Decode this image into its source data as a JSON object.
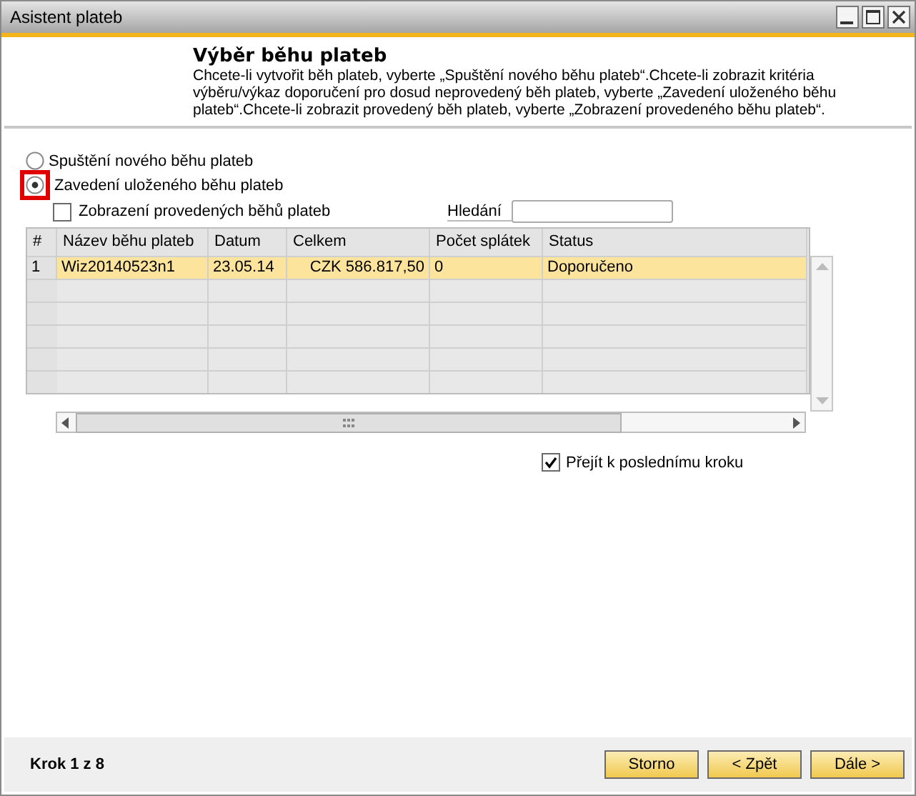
{
  "window": {
    "title": "Asistent plateb"
  },
  "header": {
    "title": "Výběr běhu plateb",
    "description": "Chcete-li vytvořit běh plateb, vyberte „Spuštění nového běhu plateb“.Chcete-li zobrazit kritéria výběru/výkaz doporučení pro dosud neprovedený běh plateb, vyberte „Zavedení uloženého běhu plateb“.Chcete-li zobrazit provedený běh plateb, vyberte „Zobrazení provedeného běhu plateb“."
  },
  "options": [
    {
      "label": "Spuštění nového běhu plateb",
      "selected": false,
      "highlighted": false
    },
    {
      "label": "Zavedení uloženého běhu plateb",
      "selected": true,
      "highlighted": true
    }
  ],
  "show_executed": {
    "label": "Zobrazení provedených běhů plateb",
    "checked": false
  },
  "search": {
    "label": "Hledání"
  },
  "table": {
    "columns": [
      "#",
      "Název běhu plateb",
      "Datum",
      "Celkem",
      "Počet splátek",
      "Status"
    ],
    "rows": [
      {
        "cells": [
          "1",
          "Wiz20140523n1",
          "23.05.14",
          "CZK 586.817,50",
          "0",
          "Doporučeno"
        ],
        "selected": true
      }
    ]
  },
  "go_to_last_step": {
    "label": "Přejít k poslednímu kroku",
    "checked": true
  },
  "footer": {
    "step": "Krok 1 z 8",
    "buttons": [
      "Storno",
      "< Zpět",
      "Dále >"
    ]
  }
}
